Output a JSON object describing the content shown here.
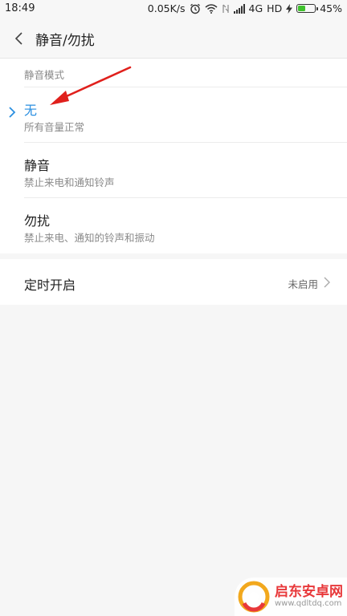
{
  "status_bar": {
    "time": "18:49",
    "speed": "0.05K/s",
    "network": "4G",
    "hd": "HD",
    "battery_percent": "45%",
    "battery_level": 0.45,
    "icons": [
      "alarm-icon",
      "wifi-icon",
      "sim-signal-icon",
      "signal-icon",
      "charging-icon",
      "battery-icon"
    ]
  },
  "header": {
    "back_icon": "chevron-left-icon",
    "title": "静音/勿扰"
  },
  "mode_section": {
    "header": "静音模式",
    "options": [
      {
        "title": "无",
        "subtitle": "所有音量正常",
        "selected": true
      },
      {
        "title": "静音",
        "subtitle": "禁止来电和通知铃声",
        "selected": false
      },
      {
        "title": "勿扰",
        "subtitle": "禁止来电、通知的铃声和振动",
        "selected": false
      }
    ]
  },
  "timer_section": {
    "label": "定时开启",
    "value": "未启用",
    "icon": "chevron-right-icon"
  },
  "colors": {
    "accent": "#2a8fe0",
    "annotation": "#e0201c",
    "battery": "#3fc22d"
  },
  "watermark": {
    "title": "启东安卓网",
    "url": "www.qdltdq.com"
  }
}
